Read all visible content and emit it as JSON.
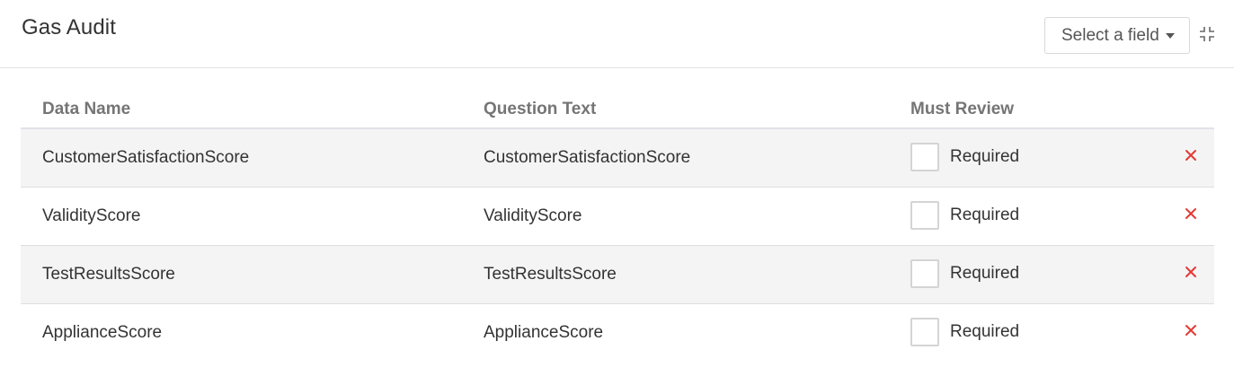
{
  "header": {
    "title": "Gas Audit",
    "field_select": {
      "selected": "Select a field",
      "icon": "caret-down-icon"
    },
    "collapse_icon": "collapse-icon"
  },
  "table": {
    "columns": [
      "Data Name",
      "Question Text",
      "Must Review"
    ],
    "rows": [
      {
        "data_name": "CustomerSatisfactionScore",
        "question_text": "CustomerSatisfactionScore",
        "required_label": "Required",
        "required_checked": false
      },
      {
        "data_name": "ValidityScore",
        "question_text": "ValidityScore",
        "required_label": "Required",
        "required_checked": false
      },
      {
        "data_name": "TestResultsScore",
        "question_text": "TestResultsScore",
        "required_label": "Required",
        "required_checked": false
      },
      {
        "data_name": "ApplianceScore",
        "question_text": "ApplianceScore",
        "required_label": "Required",
        "required_checked": false
      }
    ],
    "remove_icon": "close-icon"
  },
  "colors": {
    "remove": "#e53935",
    "row_shaded": "#f4f4f4",
    "header_text": "#757575"
  }
}
